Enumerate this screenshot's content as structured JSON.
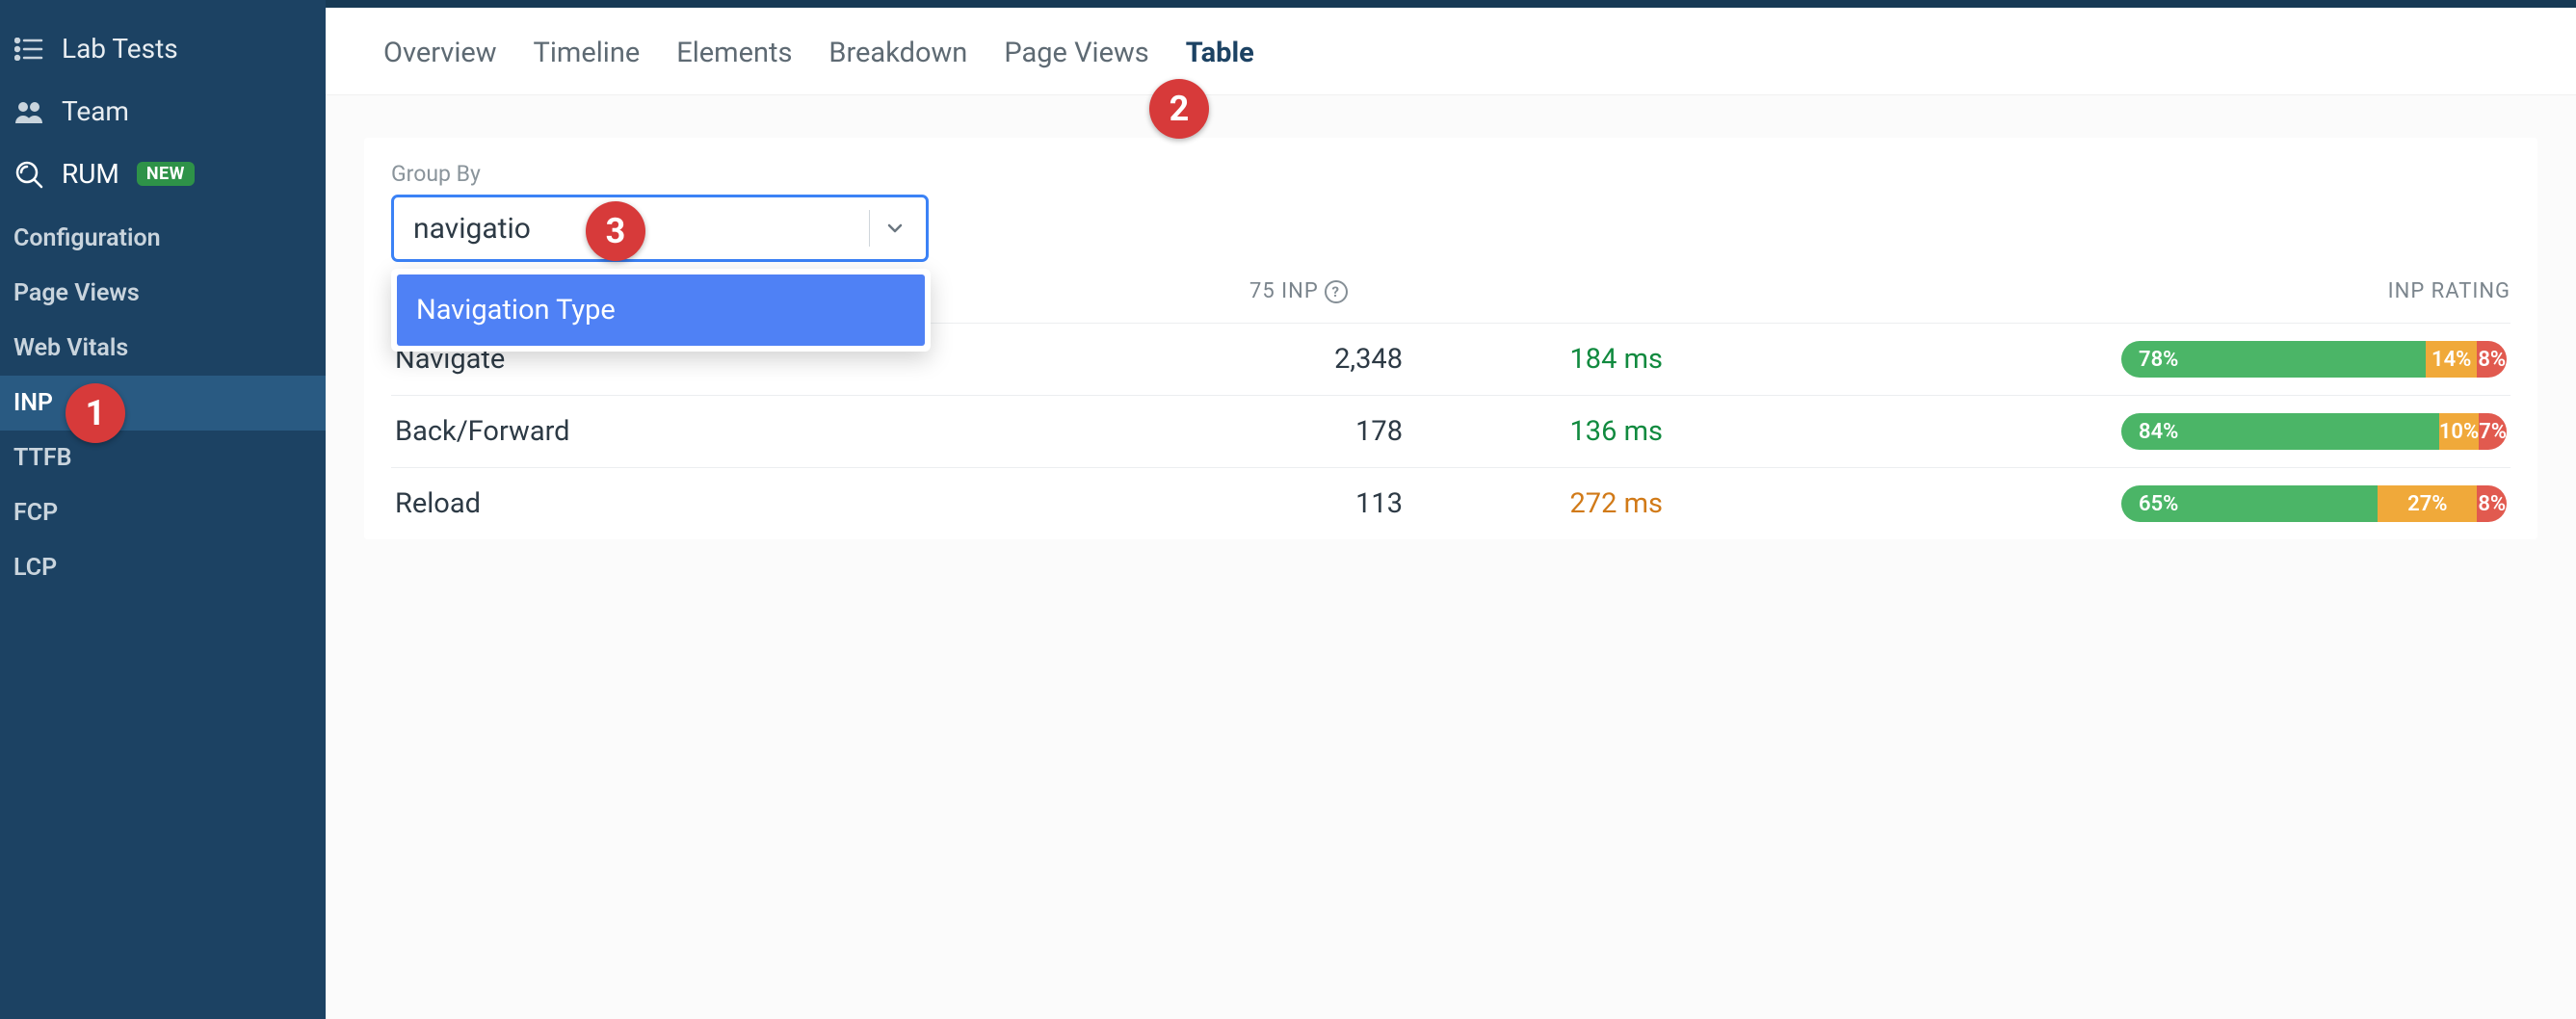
{
  "sidebar": {
    "main": [
      {
        "label": "Lab Tests",
        "icon": "list-icon"
      },
      {
        "label": "Team",
        "icon": "team-icon"
      },
      {
        "label": "RUM",
        "icon": "search-icon",
        "badge": "NEW"
      }
    ],
    "sub": [
      {
        "label": "Configuration"
      },
      {
        "label": "Page Views"
      },
      {
        "label": "Web Vitals"
      },
      {
        "label": "INP",
        "active": true
      },
      {
        "label": "TTFB"
      },
      {
        "label": "FCP"
      },
      {
        "label": "LCP"
      }
    ]
  },
  "tabs": [
    {
      "label": "Overview"
    },
    {
      "label": "Timeline"
    },
    {
      "label": "Elements"
    },
    {
      "label": "Breakdown"
    },
    {
      "label": "Page Views"
    },
    {
      "label": "Table",
      "active": true
    }
  ],
  "groupby": {
    "label": "Group By",
    "input_value": "navigatio",
    "options": [
      "Navigation Type"
    ]
  },
  "table_headers": {
    "p75": "75 INP",
    "rating": "INP RATING"
  },
  "rows": [
    {
      "name": "Navigate",
      "page_views": "2,348",
      "p75": "184 ms",
      "p75_class": "good",
      "good": "78%",
      "ni": "14%",
      "poor": "8%",
      "good_w": 78,
      "ni_w": 14,
      "poor_w": 8
    },
    {
      "name": "Back/Forward",
      "page_views": "178",
      "p75": "136 ms",
      "p75_class": "good",
      "good": "84%",
      "ni": "10%",
      "poor": "7%",
      "good_w": 83,
      "ni_w": 10,
      "poor_w": 7
    },
    {
      "name": "Reload",
      "page_views": "113",
      "p75": "272 ms",
      "p75_class": "ni",
      "good": "65%",
      "ni": "27%",
      "poor": "8%",
      "good_w": 65,
      "ni_w": 27,
      "poor_w": 8
    }
  ],
  "annotations": {
    "1": "1",
    "2": "2",
    "3": "3"
  }
}
